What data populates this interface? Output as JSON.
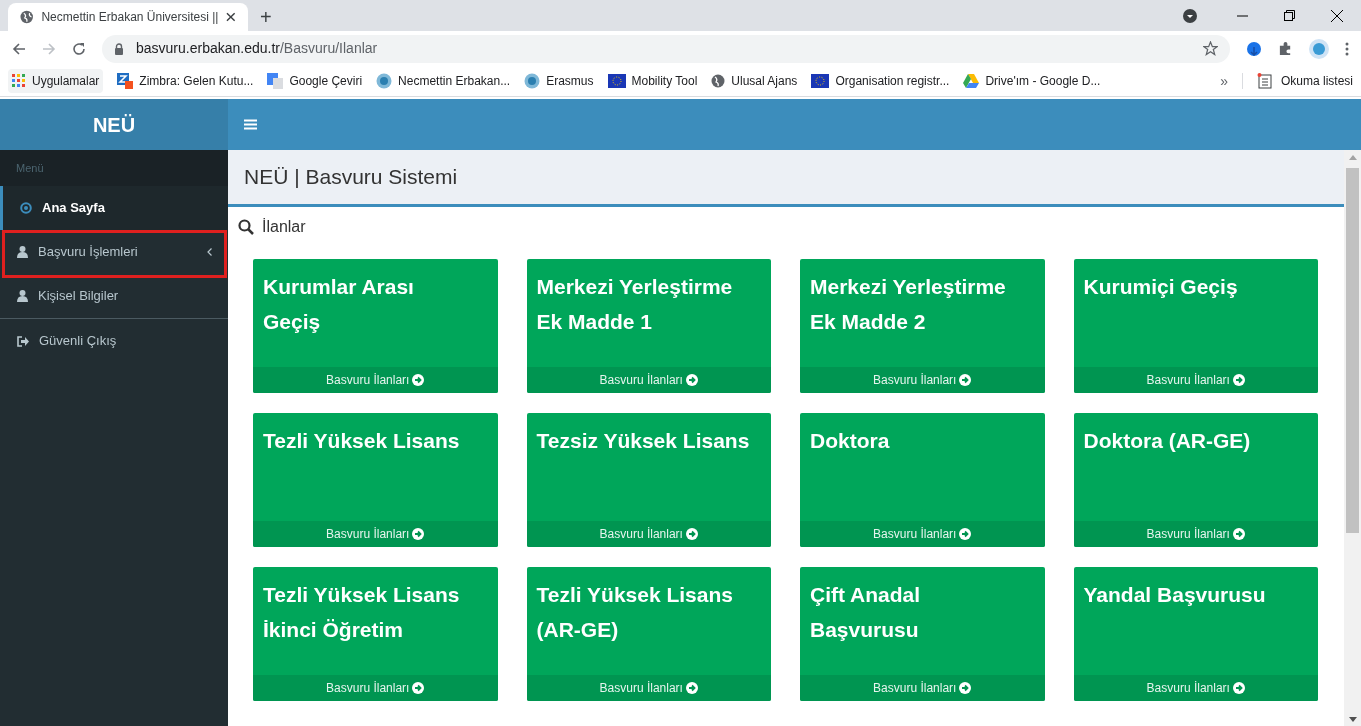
{
  "browser": {
    "tab_title": "Necmettin Erbakan Üniversitesi ||",
    "new_tab": "+",
    "address": {
      "host": "basvuru.erbakan.edu.tr",
      "path": "/Basvuru/Ilanlar"
    },
    "bookmarks": [
      {
        "label": "Uygulamalar",
        "kind": "apps"
      },
      {
        "label": "Zimbra: Gelen Kutu...",
        "kind": "zimbra"
      },
      {
        "label": "Google Çeviri",
        "kind": "translate"
      },
      {
        "label": "Necmettin Erbakan...",
        "kind": "seal"
      },
      {
        "label": "Erasmus",
        "kind": "seal"
      },
      {
        "label": "Mobility Tool",
        "kind": "eu"
      },
      {
        "label": "Ulusal Ajans",
        "kind": "globe"
      },
      {
        "label": "Organisation registr...",
        "kind": "eu"
      },
      {
        "label": "Drive'ım - Google D...",
        "kind": "drive"
      }
    ],
    "more": "»",
    "reading_list": "Okuma listesi"
  },
  "sidebar": {
    "logo": "NEÜ",
    "section": "Menü",
    "items": [
      {
        "label": "Ana Sayfa",
        "kind": "circle",
        "selected": true,
        "expandable": false,
        "highlighted": false,
        "divider_after": false
      },
      {
        "label": "Başvuru İşlemleri",
        "kind": "user",
        "selected": false,
        "expandable": true,
        "highlighted": true,
        "divider_after": false
      },
      {
        "label": "Kişisel Bilgiler",
        "kind": "user",
        "selected": false,
        "expandable": false,
        "highlighted": false,
        "divider_after": true
      },
      {
        "label": "Güvenli Çıkış",
        "kind": "signout",
        "selected": false,
        "expandable": false,
        "highlighted": false,
        "divider_after": false
      }
    ]
  },
  "page_title": "NEÜ | Basvuru Sistemi",
  "section_title": "İlanlar",
  "cards": [
    {
      "title_lines": [
        "Kurumlar Arası",
        "Geçiş"
      ],
      "link": "Basvuru İlanları"
    },
    {
      "title_lines": [
        "Merkezi Yerleştirme",
        "Ek Madde 1"
      ],
      "link": "Basvuru İlanları"
    },
    {
      "title_lines": [
        "Merkezi Yerleştirme",
        "Ek Madde 2"
      ],
      "link": "Basvuru İlanları"
    },
    {
      "title_lines": [
        "Kurumiçi Geçiş"
      ],
      "link": "Basvuru İlanları"
    },
    {
      "title_lines": [
        "Tezli Yüksek Lisans"
      ],
      "link": "Basvuru İlanları"
    },
    {
      "title_lines": [
        "Tezsiz Yüksek Lisans"
      ],
      "link": "Basvuru İlanları"
    },
    {
      "title_lines": [
        "Doktora"
      ],
      "link": "Basvuru İlanları"
    },
    {
      "title_lines": [
        "Doktora (AR-GE)"
      ],
      "link": "Basvuru İlanları"
    },
    {
      "title_lines": [
        "Tezli Yüksek Lisans",
        "İkinci Öğretim"
      ],
      "link": "Basvuru İlanları"
    },
    {
      "title_lines": [
        "Tezli Yüksek Lisans",
        "(AR-GE)"
      ],
      "link": "Basvuru İlanları"
    },
    {
      "title_lines": [
        "Çift Anadal",
        "Başvurusu"
      ],
      "link": "Basvuru İlanları"
    },
    {
      "title_lines": [
        "Yandal Başvurusu"
      ],
      "link": "Basvuru İlanları"
    }
  ]
}
